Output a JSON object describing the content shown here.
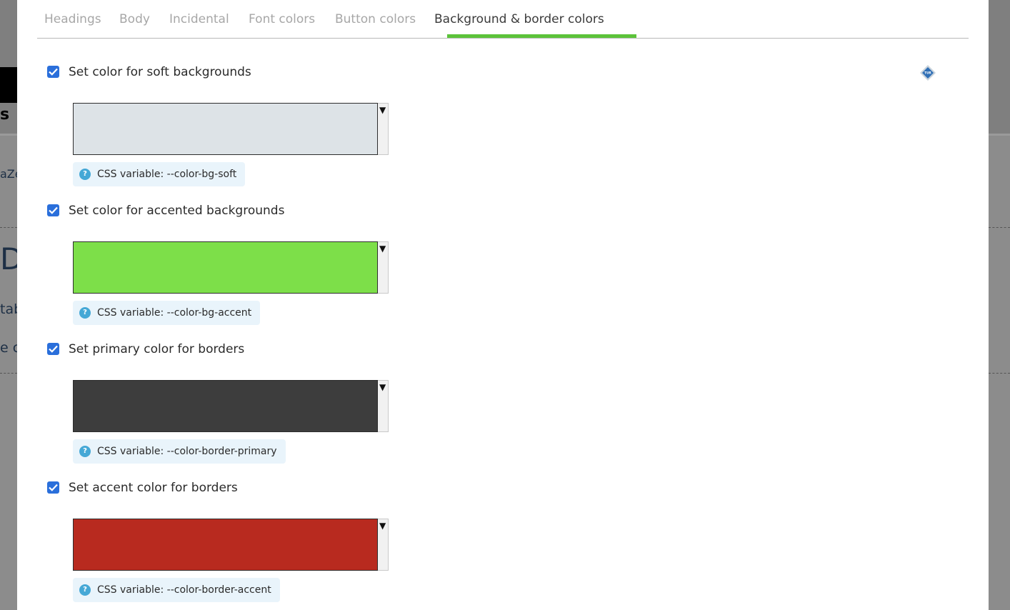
{
  "tabs": [
    {
      "label": "Headings",
      "active": false
    },
    {
      "label": "Body",
      "active": false
    },
    {
      "label": "Incidental",
      "active": false
    },
    {
      "label": "Font colors",
      "active": false
    },
    {
      "label": "Button colors",
      "active": false
    },
    {
      "label": "Background & border colors",
      "active": true
    }
  ],
  "accent_color": "#5cc33a",
  "badge": {
    "label": "TUR"
  },
  "options": [
    {
      "label": "Set color for soft backgrounds",
      "checked": true,
      "swatch_color": "#dde3e7",
      "css_variable": "CSS variable: --color-bg-soft"
    },
    {
      "label": "Set color for accented backgrounds",
      "checked": true,
      "swatch_color": "#7ddf49",
      "css_variable": "CSS variable: --color-bg-accent"
    },
    {
      "label": "Set primary color for borders",
      "checked": true,
      "swatch_color": "#3d3d3d",
      "css_variable": "CSS variable: --color-border-primary"
    },
    {
      "label": "Set accent color for borders",
      "checked": true,
      "swatch_color": "#b82a1f",
      "css_variable": "CSS variable: --color-border-accent"
    }
  ],
  "dropdown_glyph": "▼",
  "help_glyph": "?",
  "background": {
    "fragments": [
      "aZe",
      "Da",
      "tab",
      "e c",
      "s"
    ]
  }
}
